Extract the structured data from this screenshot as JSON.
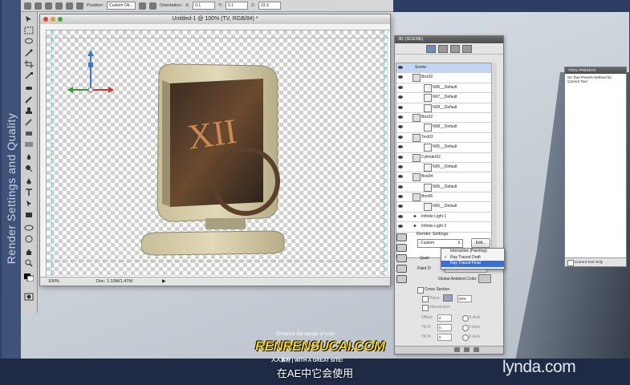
{
  "side_title": "Render Settings and Quality",
  "options_bar": {
    "position_label": "Position:",
    "position_value": "Custom Ob...",
    "orientation_label": "Orientation:",
    "x_label": "X:",
    "x_value": "0.1",
    "y_label": "Y:",
    "y_value": "0.1",
    "z_label": "Z:",
    "z_value": "23.3"
  },
  "document": {
    "title": "Untitled-1 @ 100% (TV, RGB/8#) *",
    "zoom": "100%",
    "doc_info": "Doc: 1.10M/1.47M"
  },
  "panel_3d": {
    "tab": "3D (SCENE)",
    "scene_items": [
      {
        "label": "Scene",
        "kind": "scene",
        "indent": 0,
        "selected": true
      },
      {
        "label": "Box02",
        "kind": "group",
        "indent": 1
      },
      {
        "label": "N06__Default",
        "kind": "material",
        "indent": 2
      },
      {
        "label": "N07__Default",
        "kind": "material",
        "indent": 2
      },
      {
        "label": "N08__Default",
        "kind": "material",
        "indent": 2
      },
      {
        "label": "Box02",
        "kind": "group",
        "indent": 1
      },
      {
        "label": "N08__Default",
        "kind": "material",
        "indent": 2
      },
      {
        "label": "Text02",
        "kind": "group",
        "indent": 1
      },
      {
        "label": "N05__Default",
        "kind": "material",
        "indent": 2
      },
      {
        "label": "Cylinder02",
        "kind": "group",
        "indent": 1
      },
      {
        "label": "N05__Default",
        "kind": "material",
        "indent": 2
      },
      {
        "label": "Box04",
        "kind": "group",
        "indent": 1
      },
      {
        "label": "N06__Default",
        "kind": "material",
        "indent": 2
      },
      {
        "label": "Box06",
        "kind": "group",
        "indent": 1
      },
      {
        "label": "N06__Default",
        "kind": "material",
        "indent": 2
      },
      {
        "label": "Infinite Light 1",
        "kind": "light",
        "indent": 1
      },
      {
        "label": "Infinite Light 2",
        "kind": "light",
        "indent": 1
      }
    ],
    "render_settings_label": "Render Settings",
    "preset_value": "Custom",
    "edit_button": "Edit...",
    "quality_label": "Quali",
    "paint_on_label": "Paint O",
    "global_ambient_label": "Global Ambient Color:",
    "cross_section_label": "Cross Section",
    "plane_label": "Plane:",
    "plane_value": "50%",
    "intersection_label": "Intersection",
    "offset_label": "Offset:",
    "offset_value": "0",
    "tilt_a_label": "Tilt A:",
    "tilt_a_value": "0",
    "tilt_b_label": "Tilt B:",
    "tilt_b_value": "0",
    "x_axis": "X-Axis",
    "y_axis": "Y-Axis",
    "z_axis": "Z-Axis"
  },
  "quality_dropdown": {
    "options": [
      {
        "label": "Interactive (Painting)",
        "checked": false,
        "highlighted": false
      },
      {
        "label": "Ray Traced Draft",
        "checked": true,
        "highlighted": false
      },
      {
        "label": "Ray Traced Final",
        "checked": false,
        "highlighted": true
      }
    ]
  },
  "tool_presets": {
    "tab": "TOOL PRESETS",
    "note": "No Tool Presets Defined for Current Tool",
    "footer": "Current Tool Only"
  },
  "subtitle": "在AE中它会使用",
  "watermark": {
    "tagline": "Enhance the design of your",
    "brand": "RENRENSUCAI.COM",
    "sub": "人人素材 | WITH A GREAT SITE!"
  },
  "brand_logo": "lynda.com",
  "colors": {
    "frame_blue": "#314166",
    "selection_blue": "#3a6fd9",
    "guide_cyan": "#61c6cf",
    "tv_cream": "#d8cfae"
  }
}
